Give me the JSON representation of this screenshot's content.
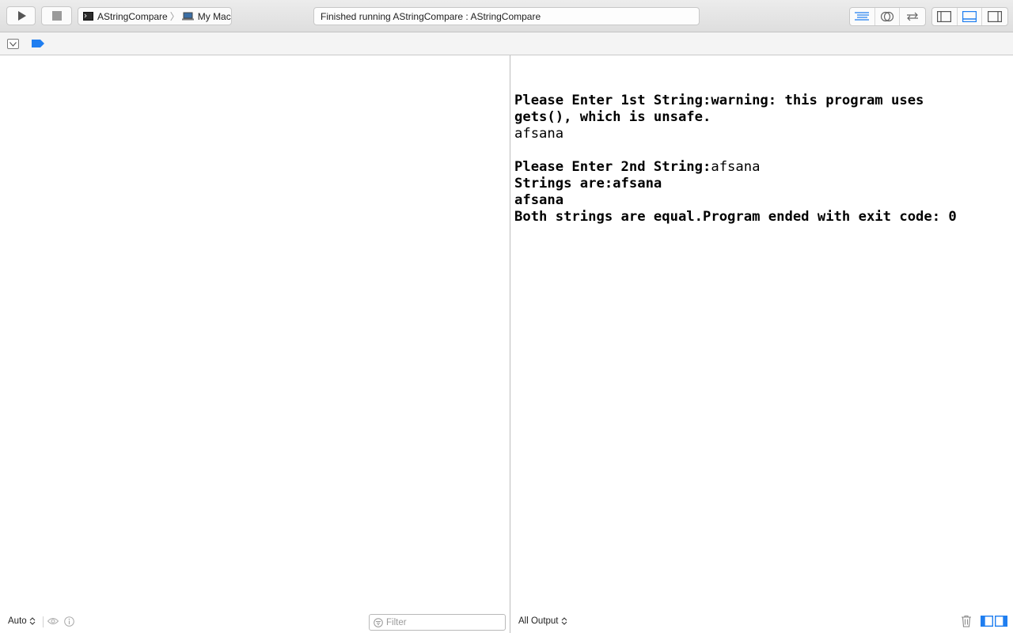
{
  "toolbar": {
    "run_icon": "play-icon",
    "stop_icon": "stop-icon",
    "scheme": {
      "target": "AStringCompare",
      "destination": "My Mac"
    },
    "status_text": "Finished running AStringCompare : AStringCompare",
    "editor_modes": [
      "standard-editor-icon",
      "assistant-editor-icon",
      "version-editor-icon"
    ],
    "view_toggles": [
      "navigator-panel-icon",
      "debug-area-icon",
      "utilities-panel-icon"
    ]
  },
  "debug_bar": {
    "hide_icon": "hide-debug-area-icon",
    "breakpoint_icon": "breakpoints-icon"
  },
  "console": {
    "lines": [
      {
        "segments": [
          {
            "text": "",
            "bold": false
          }
        ]
      },
      {
        "segments": [
          {
            "text": "Please Enter 1st String:warning: this program uses",
            "bold": true
          }
        ]
      },
      {
        "segments": [
          {
            "text": "gets(), which is unsafe.",
            "bold": true
          }
        ]
      },
      {
        "segments": [
          {
            "text": "afsana",
            "bold": false
          }
        ]
      },
      {
        "segments": [
          {
            "text": "",
            "bold": false
          }
        ]
      },
      {
        "segments": [
          {
            "text": "Please Enter 2nd String:",
            "bold": true
          },
          {
            "text": "afsana",
            "bold": false
          }
        ]
      },
      {
        "segments": [
          {
            "text": "Strings are:afsana",
            "bold": true
          }
        ]
      },
      {
        "segments": [
          {
            "text": "afsana",
            "bold": true
          }
        ]
      },
      {
        "segments": [
          {
            "text": "Both strings are equal.Program ended with exit code: 0",
            "bold": true
          }
        ]
      }
    ]
  },
  "variables_bar": {
    "scope_label": "Auto",
    "filter_placeholder": "Filter"
  },
  "console_bar": {
    "output_label": "All Output"
  },
  "colors": {
    "accent": "#1f7ef0",
    "toolbar_bg": "#e4e4e4",
    "divider": "#bdbdbd"
  }
}
